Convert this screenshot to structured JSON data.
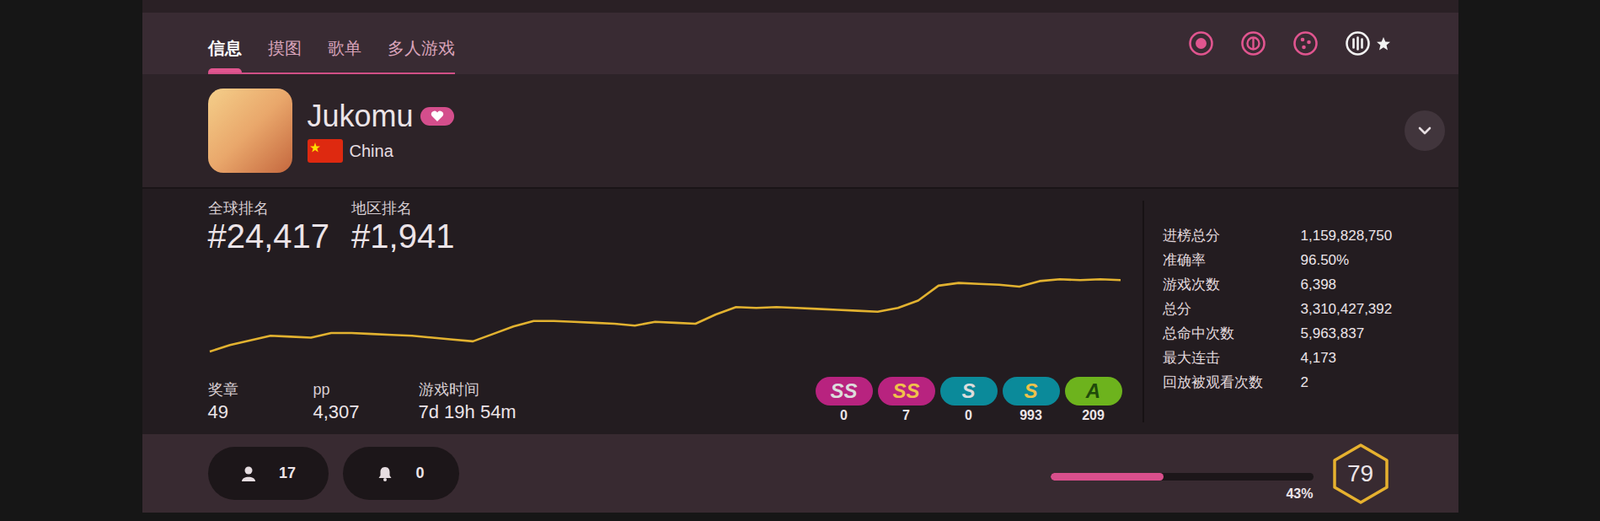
{
  "tabs": [
    {
      "label": "信息",
      "selected": true
    },
    {
      "label": "摸图",
      "selected": false
    },
    {
      "label": "歌单",
      "selected": false
    },
    {
      "label": "多人游戏",
      "selected": false
    }
  ],
  "modes": [
    {
      "kind": "osu",
      "selected": false,
      "default": false
    },
    {
      "kind": "taiko",
      "selected": false,
      "default": false
    },
    {
      "kind": "catch",
      "selected": false,
      "default": false
    },
    {
      "kind": "mania",
      "selected": true,
      "default": true
    }
  ],
  "user": {
    "name": "Jukomu",
    "supporter": true,
    "country": "China"
  },
  "ranks": [
    {
      "label": "全球排名",
      "value": "#24,417"
    },
    {
      "label": "地区排名",
      "value": "#1,941"
    }
  ],
  "rank_history": [
    0,
    7,
    12,
    17,
    16,
    15,
    20,
    20,
    19,
    18,
    17,
    15,
    13,
    11,
    19,
    27,
    33,
    33,
    32,
    31,
    30,
    28,
    32,
    31,
    30,
    40,
    48,
    47,
    48,
    47,
    46,
    45,
    44,
    43,
    47,
    55,
    71,
    74,
    73,
    72,
    70,
    76,
    78,
    77,
    78,
    77
  ],
  "summary": [
    {
      "label": "奖章",
      "value": "49"
    },
    {
      "label": "pp",
      "value": "4,307"
    },
    {
      "label": "游戏时间",
      "value": "7d 19h 54m"
    }
  ],
  "grades": [
    {
      "label": "SS",
      "count": "0",
      "color": "#b8237f",
      "text_color": "#dcdcdc"
    },
    {
      "label": "SS",
      "count": "7",
      "color": "#b8237f",
      "text_color": "#f0c24a"
    },
    {
      "label": "S",
      "count": "0",
      "color": "#0b8a9a",
      "text_color": "#dcdcdc"
    },
    {
      "label": "S",
      "count": "993",
      "color": "#0b8a9a",
      "text_color": "#f0c24a"
    },
    {
      "label": "A",
      "count": "209",
      "color": "#6db31d",
      "text_color": "#1f4a0a"
    }
  ],
  "stats": [
    {
      "label": "进榜总分",
      "value": "1,159,828,750"
    },
    {
      "label": "准确率",
      "value": "96.50%"
    },
    {
      "label": "游戏次数",
      "value": "6,398"
    },
    {
      "label": "总分",
      "value": "3,310,427,392"
    },
    {
      "label": "总命中次数",
      "value": "5,963,837"
    },
    {
      "label": "最大连击",
      "value": "4,173"
    },
    {
      "label": "回放被观看次数",
      "value": "2"
    }
  ],
  "followers": "17",
  "notifications": "0",
  "level": {
    "value": "79",
    "progress": 0.43,
    "progress_text": "43%"
  }
}
